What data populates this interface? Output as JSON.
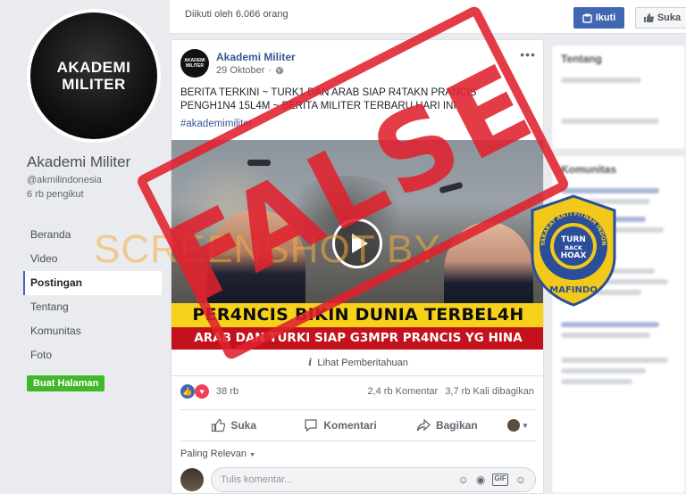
{
  "page": {
    "avatar_lines": [
      "AKADEMI",
      "MILITER"
    ],
    "name": "Akademi Militer",
    "handle": "@akmilindonesia",
    "followers_short": "6 rb pengikut",
    "followed_by": "Diikuti oleh 6.066 orang",
    "follow_label": "Ikuti",
    "like_label": "Suka",
    "create_page_label": "Buat Halaman"
  },
  "nav": {
    "items": [
      {
        "label": "Beranda"
      },
      {
        "label": "Video"
      },
      {
        "label": "Postingan",
        "active": true
      },
      {
        "label": "Tentang"
      },
      {
        "label": "Komunitas"
      },
      {
        "label": "Foto"
      }
    ]
  },
  "post": {
    "author": "Akademi Militer",
    "date": "29 Oktober",
    "text": "BERITA TERKINI ~ TURK1 DAN ARAB SIAP R4TAKN PRANCIS PENGH1N4 15L4M ~ BERITA MILITER TERBARU HARI INI",
    "hashtag": "#akademimiliter",
    "media": {
      "headline_top": "PER4NCIS BIKIN DUNIA TERBEL4H",
      "headline_bottom": "ARAB DAN TURKI SIAP G3MPR PR4NCIS YG HINA ISL4M"
    },
    "notice": "Lihat Pemberitahuan",
    "reaction_count": "38 rb",
    "comments_count": "2,4 rb Komentar",
    "shares_count": "3,7 rb Kali dibagikan",
    "actions": {
      "like": "Suka",
      "comment": "Komentari",
      "share": "Bagikan"
    },
    "sort_label": "Paling Relevan",
    "comment_placeholder": "Tulis komentar..."
  },
  "right_sidebar": {
    "cards": [
      "Tentang",
      "Komunitas"
    ]
  },
  "overlays": {
    "stamp_text": "FALSE",
    "watermark_text": "SCREENSHOT BY",
    "seal_ring_text": "MASYARAKAT ANTI FITNAH INDONESIA",
    "seal_center": [
      "TURN",
      "BACK",
      "HOAX"
    ],
    "seal_bottom": "MAFINDO"
  },
  "colors": {
    "fb_blue": "#4267b2",
    "link_blue": "#385898",
    "green_button": "#42b72a",
    "stamp_red": "#e0212d",
    "headline_yellow": "#f7d21b",
    "headline_red": "#c3121b",
    "seal_blue": "#2a4e9a",
    "seal_yellow": "#f2c81a"
  }
}
